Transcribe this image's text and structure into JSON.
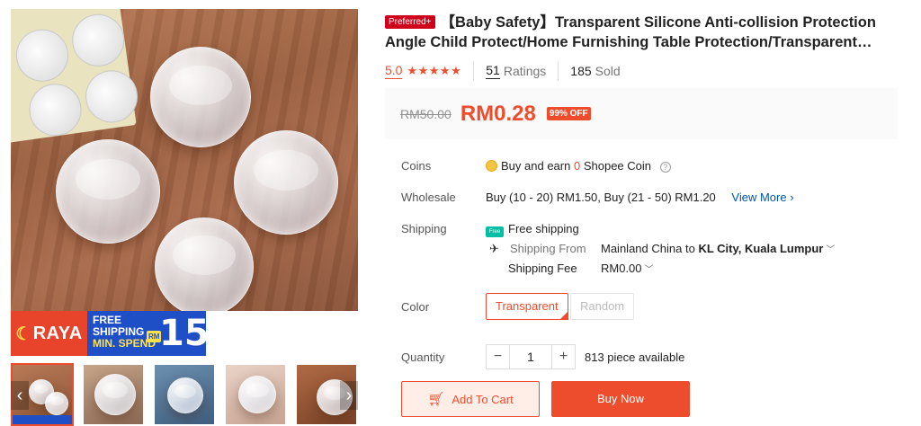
{
  "gallery": {
    "promo": {
      "brand": "RAYA",
      "line1": "FREE",
      "line2": "SHIPPING",
      "line3": "MIN. SPEND",
      "currency": "RM",
      "amount": "15"
    },
    "nav_prev": "‹",
    "nav_next": "›"
  },
  "product": {
    "badge": "Preferred+",
    "title": "【Baby Safety】Transparent Silicone Anti-collision Protection Angle Child Protect/Home Furnishing Table Protection/Transparent…",
    "rating": "5.0",
    "stars": "★★★★★",
    "ratings_count": "51",
    "ratings_label": "Ratings",
    "sold_count": "185",
    "sold_label": "Sold"
  },
  "price": {
    "original": "RM50.00",
    "current": "RM0.28",
    "discount": "99% OFF"
  },
  "details": {
    "coins_label": "Coins",
    "coins_text_before": "Buy and earn",
    "coins_amount": "0",
    "coins_text_after": "Shopee Coin",
    "wholesale_label": "Wholesale",
    "wholesale_text": "Buy (10 - 20) RM1.50, Buy (21 - 50) RM1.20",
    "view_more": "View More",
    "shipping_label": "Shipping",
    "free_shipping_icon": "Free",
    "free_shipping": "Free shipping",
    "shipping_from_label": "Shipping From",
    "shipping_from_value": "Mainland China",
    "shipping_to_word": "to",
    "shipping_to_value": "KL City, Kuala Lumpur",
    "shipping_fee_label": "Shipping Fee",
    "shipping_fee_value": "RM0.00"
  },
  "variants": {
    "label": "Color",
    "options": [
      "Transparent",
      "Random"
    ],
    "selected": "Transparent"
  },
  "quantity": {
    "label": "Quantity",
    "value": "1",
    "minus": "−",
    "plus": "+",
    "available": "813 piece available"
  },
  "actions": {
    "add_to_cart": "Add To Cart",
    "buy_now": "Buy Now"
  },
  "colors": {
    "accent": "#ee4d2d",
    "preferred": "#d0011b",
    "link": "#0055aa"
  }
}
